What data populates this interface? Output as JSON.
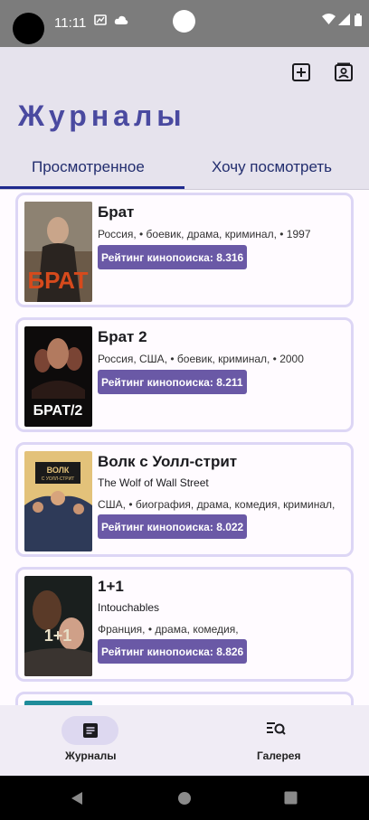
{
  "status_bar": {
    "time": "11:11"
  },
  "header": {
    "title": "Журналы"
  },
  "tabs": [
    {
      "label": "Просмотренное",
      "selected": true
    },
    {
      "label": "Хочу посмотреть",
      "selected": false
    }
  ],
  "movies": [
    {
      "title": "Брат",
      "original_title": "",
      "meta": "Россия, • боевик, драма, криминал, • 1997",
      "rating": "Рейтинг кинопоиска: 8.316"
    },
    {
      "title": "Брат 2",
      "original_title": "",
      "meta": "Россия, США, • боевик, криминал, • 2000",
      "rating": "Рейтинг кинопоиска: 8.211"
    },
    {
      "title": "Волк с Уолл-стрит",
      "original_title": "The Wolf of Wall Street",
      "meta": "США, • биография, драма, комедия, криминал,",
      "rating": "Рейтинг кинопоиска: 8.022"
    },
    {
      "title": "1+1",
      "original_title": "Intouchables",
      "meta": "Франция, • драма, комедия,",
      "rating": "Рейтинг кинопоиска: 8.826"
    }
  ],
  "bottom_nav": [
    {
      "label": "Журналы",
      "icon": "journal-icon",
      "selected": true
    },
    {
      "label": "Галерея",
      "icon": "gallery-search-icon",
      "selected": false
    }
  ],
  "colors": {
    "accent": "#6a59a6",
    "title": "#4a4aa0",
    "card_border": "#ddd6f5"
  }
}
